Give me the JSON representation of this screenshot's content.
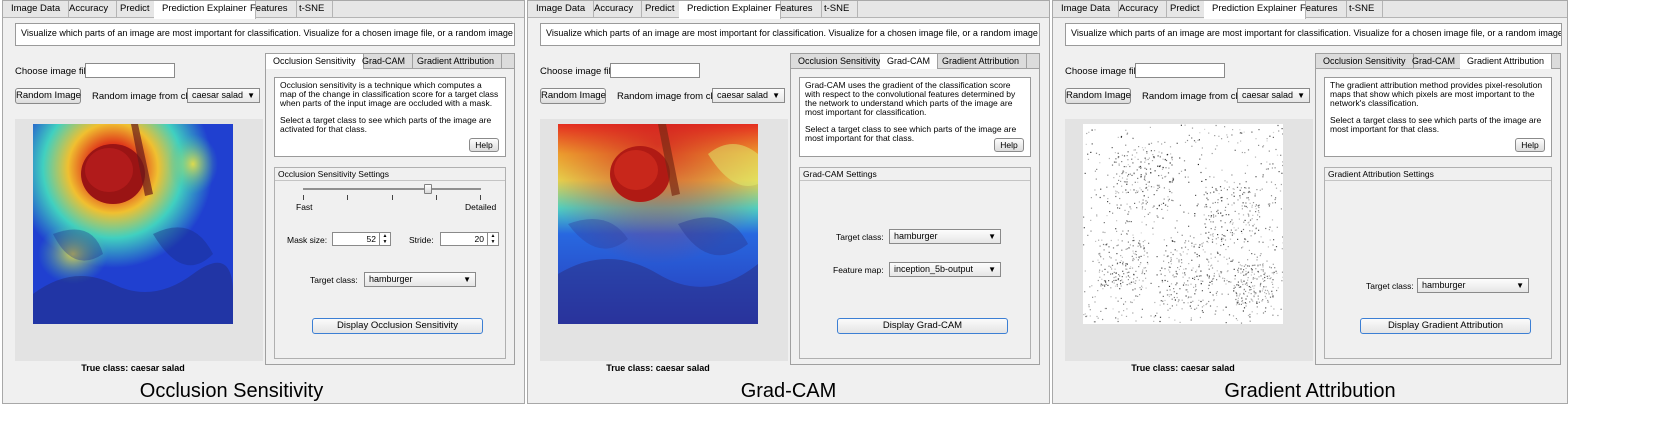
{
  "top_tabs": [
    "Image Data",
    "Accuracy",
    "Predict",
    "Prediction Explainer",
    "Features",
    "t-SNE"
  ],
  "active_top_tab": "Prediction Explainer",
  "description": "Visualize which parts of an image are most important for classification. Visualize for a chosen image file, or a random image from the test data.",
  "choose_image_label": "Choose image file:",
  "random_image_button": "Random Image",
  "random_from_class_label": "Random image from class",
  "random_class_value": "caesar salad",
  "true_class_text": "True class: caesar salad",
  "method_tabs": [
    "Occlusion Sensitivity",
    "Grad-CAM",
    "Gradient Attribution"
  ],
  "help_button": "Help",
  "target_class_label": "Target class:",
  "target_class_value": "hamburger",
  "occlusion": {
    "info_p1": "Occlusion sensitivity is a technique which computes a map of the change in classification score for a target class when parts of the input image are occluded with a mask.",
    "info_p2": "Select a target class to see which parts of the image are activated for that class.",
    "settings_title": "Occlusion Sensitivity Settings",
    "slider_min_label": "Fast",
    "slider_max_label": "Detailed",
    "slider_level": 0.7,
    "mask_size_label": "Mask size:",
    "mask_size_value": "52",
    "stride_label": "Stride:",
    "stride_value": "20",
    "display_button": "Display Occlusion Sensitivity",
    "caption": "Occlusion Sensitivity"
  },
  "gradcam": {
    "info_p1": "Grad-CAM uses the gradient of the classification score with respect to the convolutional features determined by the network to understand which parts of the image are most important for classification.",
    "info_p2": "Select a target class to see which parts of the image are most important for that class.",
    "settings_title": "Grad-CAM Settings",
    "feature_map_label": "Feature map:",
    "feature_map_value": "inception_5b-output",
    "display_button": "Display Grad-CAM",
    "caption": "Grad-CAM"
  },
  "gradient": {
    "info_p1": "The gradient attribution method provides pixel-resolution maps that show which pixels are most important to the network's classification.",
    "info_p2": "Select a target class to see which parts of the image are most important for that class.",
    "settings_title": "Gradient Attribution Settings",
    "display_button": "Display Gradient Attribution",
    "caption": "Gradient Attribution"
  }
}
